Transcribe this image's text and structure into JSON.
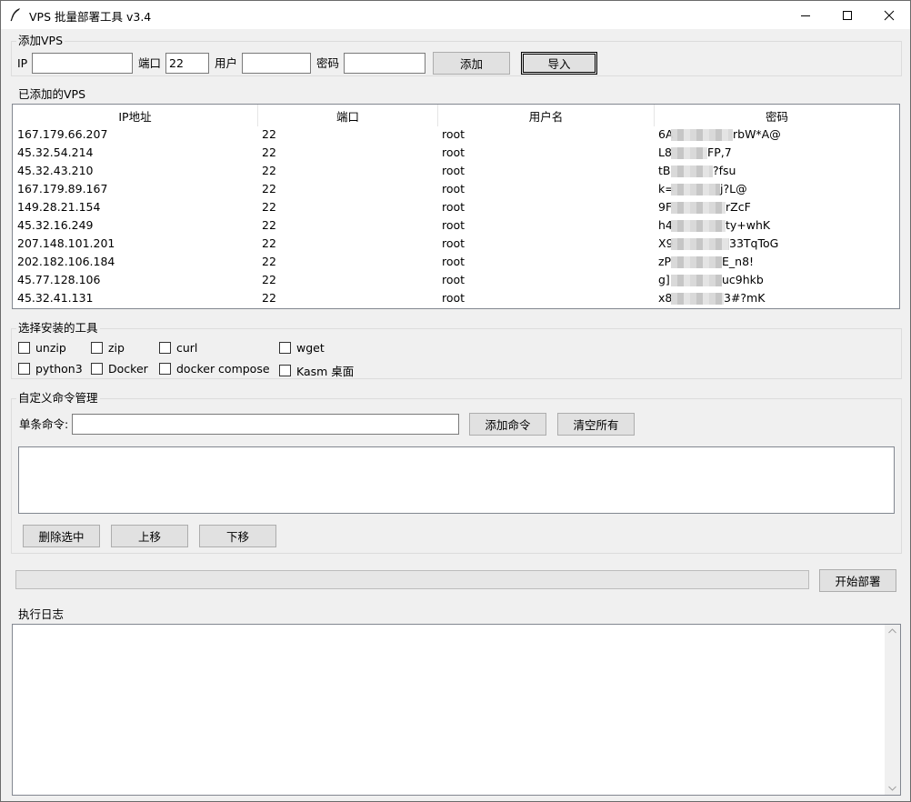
{
  "window": {
    "title": "VPS 批量部署工具 v3.4"
  },
  "add_vps": {
    "group_title": "添加VPS",
    "ip_label": "IP",
    "port_label": "端口",
    "port_value": "22",
    "user_label": "用户",
    "password_label": "密码",
    "add_button": "添加",
    "import_button": "导入"
  },
  "vps_list": {
    "group_title": "已添加的VPS",
    "columns": [
      "IP地址",
      "端口",
      "用户名",
      "密码"
    ],
    "rows": [
      {
        "ip": "167.179.66.207",
        "port": "22",
        "user": "root",
        "pw_prefix": "6A",
        "pw_suffix": "rbW*A@"
      },
      {
        "ip": "45.32.54.214",
        "port": "22",
        "user": "root",
        "pw_prefix": "L8",
        "pw_suffix": "FP,7"
      },
      {
        "ip": "45.32.43.210",
        "port": "22",
        "user": "root",
        "pw_prefix": "tB",
        "pw_suffix": "?fsu"
      },
      {
        "ip": "167.179.89.167",
        "port": "22",
        "user": "root",
        "pw_prefix": "k=",
        "pw_suffix": "j?L@"
      },
      {
        "ip": "149.28.21.154",
        "port": "22",
        "user": "root",
        "pw_prefix": "9F",
        "pw_suffix": "rZcF"
      },
      {
        "ip": "45.32.16.249",
        "port": "22",
        "user": "root",
        "pw_prefix": "h4",
        "pw_suffix": "ty+whK"
      },
      {
        "ip": "207.148.101.201",
        "port": "22",
        "user": "root",
        "pw_prefix": "X9",
        "pw_suffix": "33TqToG"
      },
      {
        "ip": "202.182.106.184",
        "port": "22",
        "user": "root",
        "pw_prefix": "zP",
        "pw_suffix": "E_n8!"
      },
      {
        "ip": "45.77.128.106",
        "port": "22",
        "user": "root",
        "pw_prefix": "g]",
        "pw_suffix": "uc9hkb"
      },
      {
        "ip": "45.32.41.131",
        "port": "22",
        "user": "root",
        "pw_prefix": "x8",
        "pw_suffix": "3#?mK"
      }
    ]
  },
  "tools": {
    "group_title": "选择安装的工具",
    "items": [
      "unzip",
      "zip",
      "curl",
      "wget",
      "python3",
      "Docker",
      "docker compose",
      "Kasm 桌面"
    ]
  },
  "commands": {
    "group_title": "自定义命令管理",
    "single_label": "单条命令:",
    "add_button": "添加命令",
    "clear_button": "清空所有",
    "delete_button": "删除选中",
    "up_button": "上移",
    "down_button": "下移"
  },
  "deploy": {
    "start_button": "开始部署",
    "progress": 0
  },
  "log": {
    "group_title": "执行日志"
  },
  "icons": [
    "feather-icon",
    "minimize-icon",
    "maximize-icon",
    "close-icon",
    "scroll-up-icon",
    "scroll-down-icon"
  ]
}
